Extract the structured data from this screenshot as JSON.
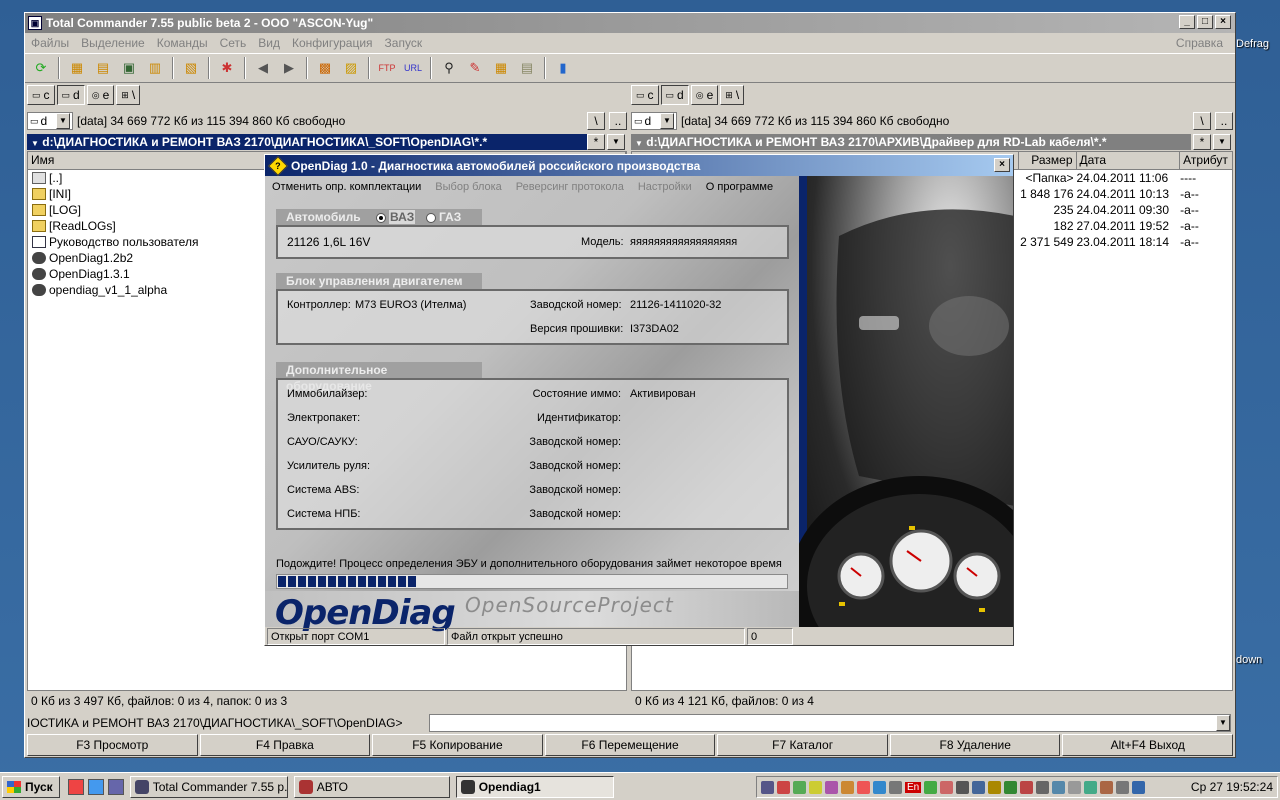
{
  "desktop": {
    "labels": [
      "Defrag",
      "down"
    ]
  },
  "tc": {
    "title": "Total Commander 7.55 public beta 2 - OOO \"ASCON-Yug\"",
    "menu": [
      "Файлы",
      "Выделение",
      "Команды",
      "Сеть",
      "Вид",
      "Конфигурация",
      "Запуск"
    ],
    "help": "Справка",
    "left": {
      "drives": [
        "c",
        "d",
        "e",
        "\\"
      ],
      "drive_selected": "d",
      "drive_combo": "d",
      "free": "[data]  34 669 772 Кб из 115 394 860 Кб свободно",
      "path": "d:\\ДИАГНОСТИКА и РЕМОНТ ВАЗ 2170\\ДИАГНОСТИКА\\_SOFT\\OpenDIAG\\*.*",
      "col_name": "Имя",
      "files": [
        {
          "name": "[..]",
          "kind": "up"
        },
        {
          "name": "[INI]",
          "kind": "folder"
        },
        {
          "name": "[LOG]",
          "kind": "folder"
        },
        {
          "name": "[ReadLOGs]",
          "kind": "folder"
        },
        {
          "name": "Руководство пользователя",
          "kind": "doc"
        },
        {
          "name": "OpenDiag1.2b2",
          "kind": "exe"
        },
        {
          "name": "OpenDiag1.3.1",
          "kind": "exe"
        },
        {
          "name": "opendiag_v1_1_alpha",
          "kind": "exe"
        }
      ],
      "status": "0 Кб из 3 497 Кб, файлов: 0 из 4, папок: 0 из 3"
    },
    "right": {
      "drives": [
        "c",
        "d",
        "e",
        "\\"
      ],
      "drive_selected": "d",
      "drive_combo": "d",
      "free": "[data]  34 669 772 Кб из 115 394 860 Кб свободно",
      "path": "d:\\ДИАГНОСТИКА и РЕМОНТ ВАЗ 2170\\АРХИВ\\Драйвер для RD-Lab кабеля\\*.*",
      "col_size": "Размер",
      "col_date": "Дата",
      "col_attr": "Атрибут",
      "files": [
        {
          "size": "<Папка>",
          "date": "24.04.2011 11:06",
          "attr": "----"
        },
        {
          "size": "1 848 176",
          "date": "24.04.2011 10:13",
          "attr": "-a--"
        },
        {
          "size": "235",
          "date": "24.04.2011 09:30",
          "attr": "-a--"
        },
        {
          "size": "182",
          "date": "27.04.2011 19:52",
          "attr": "-a--"
        },
        {
          "size": "2 371 549",
          "date": "23.04.2011 18:14",
          "attr": "-a--"
        }
      ],
      "status": "0 Кб из 4 121 Кб, файлов: 0 из 4"
    },
    "filter_btn": "*",
    "root_btn": "\\",
    "up_btn": "..",
    "cmd_path": "ІОСТИКА и РЕМОНТ ВАЗ 2170\\ДИАГНОСТИКА\\_SOFT\\OpenDIAG>",
    "fkeys": [
      "F3 Просмотр",
      "F4 Правка",
      "F5 Копирование",
      "F6 Перемещение",
      "F7 Каталог",
      "F8 Удаление",
      "Alt+F4 Выход"
    ]
  },
  "od": {
    "title": "OpenDiag 1.0 - Диагностика автомобилей российского производства",
    "menu": [
      {
        "label": "Отменить опр. комплектации",
        "enabled": true
      },
      {
        "label": "Выбор блока",
        "enabled": false
      },
      {
        "label": "Реверсинг протокола",
        "enabled": false
      },
      {
        "label": "Настройки",
        "enabled": false
      },
      {
        "label": "О программе",
        "enabled": true
      }
    ],
    "car": {
      "title": "Автомобиль",
      "opt_vaz": "ВАЗ",
      "opt_gaz": "ГАЗ",
      "selected": "ВАЗ",
      "engine": "21126 1,6L 16V",
      "model_label": "Модель:",
      "model_value": "яяяяяяяяяяяяяяяяяя"
    },
    "ecu": {
      "title": "Блок управления  двигателем",
      "controller_label": "Контроллер:",
      "controller_value": "M73 EURO3 (Ителма)",
      "serial_label": "Заводской номер:",
      "serial_value": "21126-1411020-32",
      "fw_label": "Версия прошивки:",
      "fw_value": "I373DA02"
    },
    "extra": {
      "title": "Дополнительное оборудование",
      "rows": [
        {
          "label": "Иммобилайзер:",
          "right_label": "Состояние иммо:",
          "right_value": "Активирован"
        },
        {
          "label": "Электропакет:",
          "right_label": "Идентификатор:",
          "right_value": ""
        },
        {
          "label": "САУО/САУКУ:",
          "right_label": "Заводской номер:",
          "right_value": ""
        },
        {
          "label": "Усилитель руля:",
          "right_label": "Заводской номер:",
          "right_value": ""
        },
        {
          "label": "Система ABS:",
          "right_label": "Заводской номер:",
          "right_value": ""
        },
        {
          "label": "Система НПБ:",
          "right_label": "Заводской номер:",
          "right_value": ""
        }
      ]
    },
    "wait_text": "Подождите! Процесс определения ЭБУ и дополнительного оборудования  займет некоторое время",
    "progress": 0.27,
    "logo": "OpenDiag",
    "subtitle": "OpenSourceProject",
    "status": [
      "Открыт порт COM1",
      "Файл открыт успешно",
      "0"
    ]
  },
  "taskbar": {
    "start": "Пуск",
    "tasks": [
      {
        "label": "Total Commander 7.55 p...",
        "active": false
      },
      {
        "label": "АВТО",
        "active": false
      },
      {
        "label": "Opendiag1",
        "active": true
      }
    ],
    "tray_lang": "En",
    "clock": "Ср 27 19:52:24"
  }
}
